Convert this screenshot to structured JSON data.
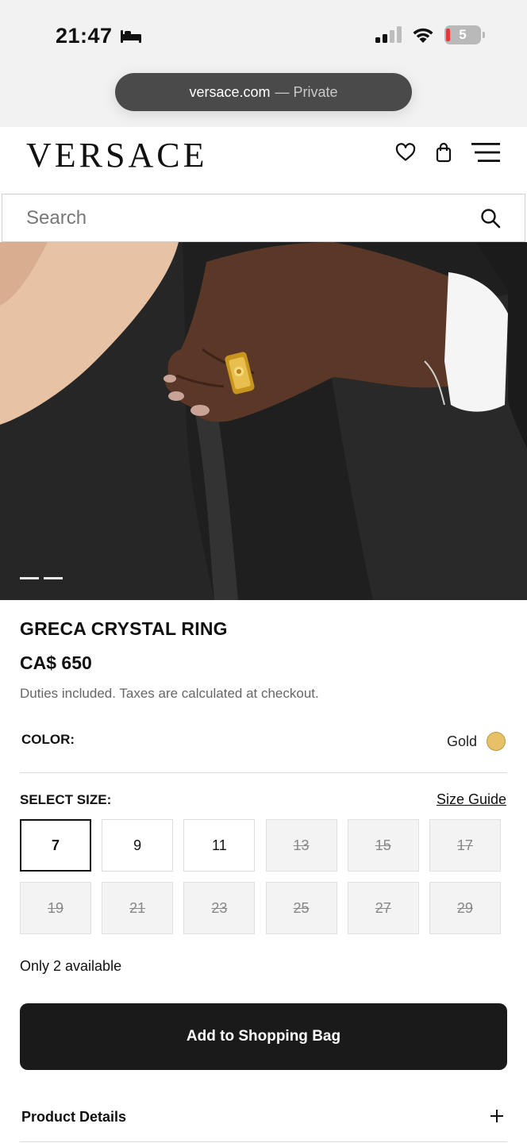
{
  "status_bar": {
    "time": "21:47",
    "battery_level": "5",
    "sleep_icon": "bed-icon",
    "signal_icon": "cellular-signal-icon",
    "wifi_icon": "wifi-icon"
  },
  "browser": {
    "domain": "versace.com",
    "mode": "— Private"
  },
  "header": {
    "logo": "VERSACE",
    "icons": [
      "heart-icon",
      "shopping-bag-icon",
      "menu-icon"
    ]
  },
  "search": {
    "placeholder": "Search"
  },
  "hero": {
    "carousel_slides": 2,
    "current_slide": 1
  },
  "product": {
    "title": "GRECA CRYSTAL RING",
    "price": "CA$ 650",
    "duties_note": "Duties included. Taxes are calculated at checkout.",
    "color_label": "COLOR:",
    "color_value": "Gold",
    "swatch_color": "#e7c067",
    "size_label": "SELECT SIZE:",
    "size_guide": "Size Guide",
    "sizes": [
      {
        "label": "7",
        "state": "selected"
      },
      {
        "label": "9",
        "state": "available"
      },
      {
        "label": "11",
        "state": "available"
      },
      {
        "label": "13",
        "state": "unavailable"
      },
      {
        "label": "15",
        "state": "unavailable"
      },
      {
        "label": "17",
        "state": "unavailable"
      },
      {
        "label": "19",
        "state": "unavailable"
      },
      {
        "label": "21",
        "state": "unavailable"
      },
      {
        "label": "23",
        "state": "unavailable"
      },
      {
        "label": "25",
        "state": "unavailable"
      },
      {
        "label": "27",
        "state": "unavailable"
      },
      {
        "label": "29",
        "state": "unavailable"
      }
    ],
    "availability": "Only 2 available",
    "add_to_bag": "Add to Shopping Bag",
    "details_label": "Product Details"
  }
}
